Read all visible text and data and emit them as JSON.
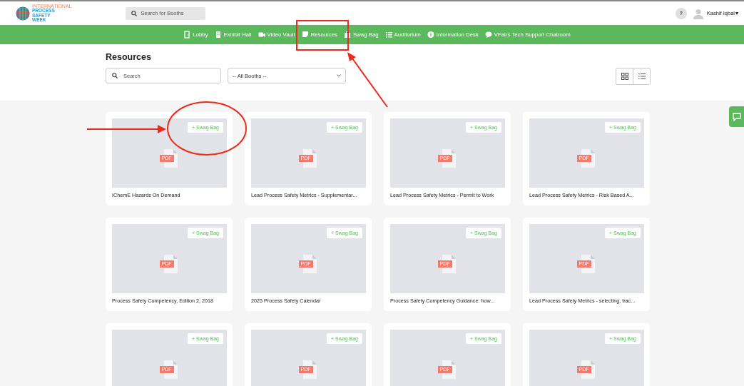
{
  "header": {
    "logo": {
      "small_text": "INTERNATIONAL",
      "lines": [
        "PROCESS",
        "SAFETY",
        "WEEK"
      ]
    },
    "search": {
      "placeholder": "Search for Booths"
    },
    "help_label": "?",
    "user_name": "Kashif Iqbal",
    "user_caret": "▾"
  },
  "nav": [
    {
      "label": "Lobby"
    },
    {
      "label": "Exhibit Hall"
    },
    {
      "label": "Video Vault"
    },
    {
      "label": "Resources"
    },
    {
      "label": "Swag Bag"
    },
    {
      "label": "Auditorium"
    },
    {
      "label": "Information Desk"
    },
    {
      "label": "VFairs Tech Support Chatroom"
    }
  ],
  "page_title": "Resources",
  "search": {
    "placeholder": "Search"
  },
  "booth_filter": {
    "value": "-- All Booths --"
  },
  "view_modes": [
    {
      "kind": "grid"
    },
    {
      "kind": "list"
    }
  ],
  "resources": [
    {
      "title": "IChemE Hazards On Demand",
      "button": "+ Swag Bag",
      "badge": "PDF"
    },
    {
      "title": "Lead Process Safety Metrics - Supplementar...",
      "button": "+ Swag Bag",
      "badge": "PDF"
    },
    {
      "title": "Lead Process Safety Metrics - Permit to Work",
      "button": "+ Swag Bag",
      "badge": "PDF"
    },
    {
      "title": "Lead Process Safety Metrics - Risk Based A...",
      "button": "+ Swag Bag",
      "badge": "PDF"
    },
    {
      "title": "Process Safety Competency, Edition 2, 2018",
      "button": "+ Swag Bag",
      "badge": "PDF"
    },
    {
      "title": "2025 Process Safety Calendar",
      "button": "+ Swag Bag",
      "badge": "PDF"
    },
    {
      "title": "Process Safety Competency Guidance: how...",
      "button": "+ Swag Bag",
      "badge": "PDF"
    },
    {
      "title": "Lead Process Safety Metrics - selecting, trac...",
      "button": "+ Swag Bag",
      "badge": "PDF"
    },
    {
      "button": "+ Swag Bag",
      "badge": "PDF"
    },
    {
      "button": "+ Swag Bag",
      "badge": "PDF"
    },
    {
      "button": "+ Swag Bag",
      "badge": "PDF"
    },
    {
      "button": "+ Swag Bag",
      "badge": "PDF"
    }
  ],
  "annotations": [
    {
      "kind": "box"
    },
    {
      "kind": "arrow-up"
    },
    {
      "kind": "ellipse"
    },
    {
      "kind": "arrow-right"
    }
  ]
}
